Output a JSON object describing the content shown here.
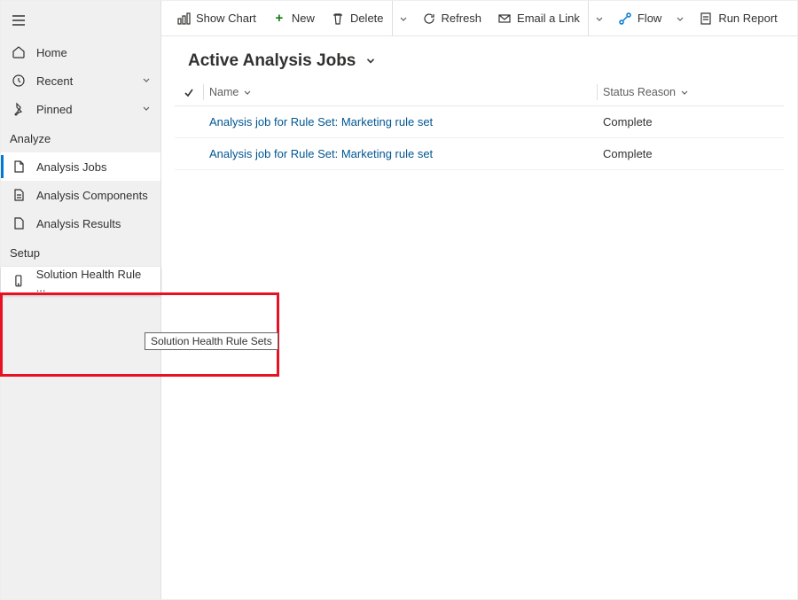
{
  "sidebar": {
    "nav": [
      {
        "label": "Home"
      },
      {
        "label": "Recent"
      },
      {
        "label": "Pinned"
      }
    ],
    "section_analyze": "Analyze",
    "analyze_items": [
      {
        "label": "Analysis Jobs"
      },
      {
        "label": "Analysis Components"
      },
      {
        "label": "Analysis Results"
      }
    ],
    "section_setup": "Setup",
    "setup_items": [
      {
        "label": "Solution Health Rule ..."
      }
    ],
    "tooltip": "Solution Health Rule Sets"
  },
  "commands": {
    "show_chart": "Show Chart",
    "new": "New",
    "delete": "Delete",
    "refresh": "Refresh",
    "email_link": "Email a Link",
    "flow": "Flow",
    "run_report": "Run Report"
  },
  "view": {
    "title": "Active Analysis Jobs"
  },
  "columns": {
    "name": "Name",
    "status": "Status Reason"
  },
  "rows": [
    {
      "name": "Analysis job for Rule Set: Marketing rule set",
      "status": "Complete"
    },
    {
      "name": "Analysis job for Rule Set: Marketing rule set",
      "status": "Complete"
    }
  ]
}
